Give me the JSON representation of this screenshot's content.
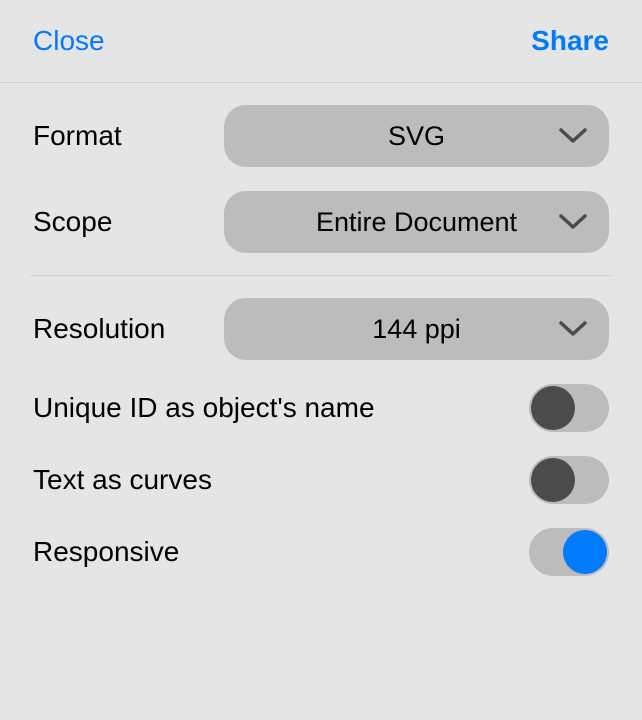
{
  "header": {
    "close": "Close",
    "share": "Share"
  },
  "section1": {
    "format_label": "Format",
    "format_value": "SVG",
    "scope_label": "Scope",
    "scope_value": "Entire Document"
  },
  "section2": {
    "resolution_label": "Resolution",
    "resolution_value": "144 ppi",
    "unique_id_label": "Unique ID as object's name",
    "unique_id_on": false,
    "text_curves_label": "Text as curves",
    "text_curves_on": false,
    "responsive_label": "Responsive",
    "responsive_on": true
  }
}
